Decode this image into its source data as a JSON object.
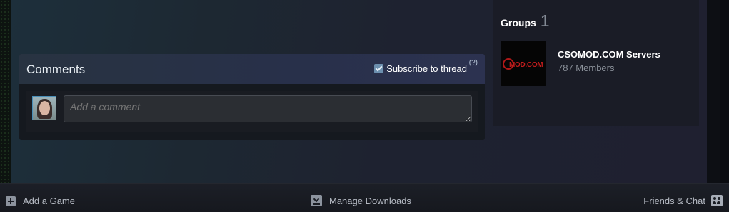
{
  "comments": {
    "title": "Comments",
    "subscribe_label": "Subscribe to thread",
    "subscribe_checked": true,
    "help_label": "(?)",
    "input_placeholder": "Add a comment"
  },
  "groups": {
    "label": "Groups",
    "count": "1",
    "items": [
      {
        "name": "CSOMOD.COM Servers",
        "members": "787 Members",
        "logo_text": "MOD.COM"
      }
    ]
  },
  "bottombar": {
    "add_game": "Add a Game",
    "manage_downloads": "Manage Downloads",
    "friends_chat": "Friends & Chat"
  },
  "colors": {
    "accent": "#6c8fae",
    "logo_red": "#c01c1c"
  }
}
